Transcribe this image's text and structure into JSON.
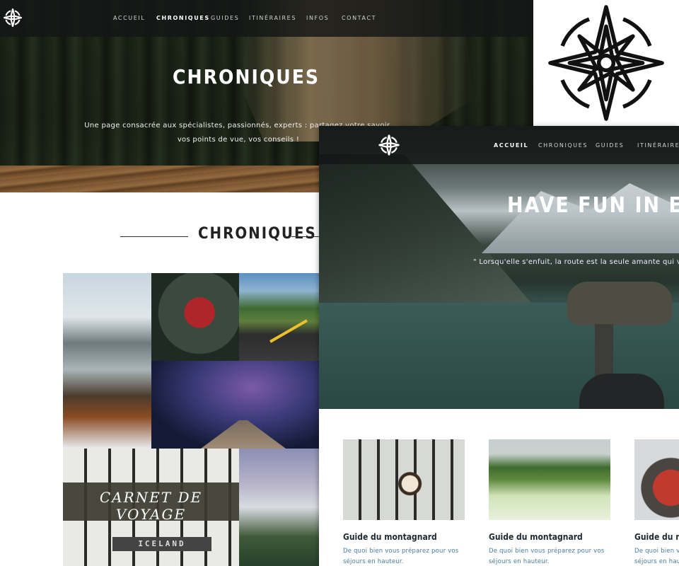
{
  "back_page": {
    "nav": [
      "ACCUEIL",
      "CHRONIQUES",
      "GUIDES",
      "ITINÉRAIRES",
      "INFOS",
      "CONTACT"
    ],
    "active_nav": "CHRONIQUES",
    "hero_title": "CHRONIQUES",
    "hero_subtitle_line1": "Une page consacrée aux spécialistes, passionnés, experts : partagez votre savoir,",
    "hero_subtitle_line2": "vos points de vue, vos conseils !",
    "section_title": "CHRONIQUES",
    "gallery_label": "CARNET DE VOYAGE",
    "iceland_text": "ICELAND"
  },
  "front_page": {
    "nav": [
      "ACCUEIL",
      "CHRONIQUES",
      "GUIDES",
      "ITINÉRAIRES"
    ],
    "active_nav": "ACCUEIL",
    "hero_title": "HAVE FUN IN EU",
    "hero_quote": "\" Lorsqu'elle s'enfuit, la route est la seule amante qui va",
    "cards": [
      {
        "title": "Guide du montagnard",
        "desc_line1": "De quoi bien vous préparez pour vos",
        "desc_line2": "séjours en hauteur."
      },
      {
        "title": "Guide du montagnard",
        "desc_line1": "De quoi bien vous préparez pour vos",
        "desc_line2": "séjours en hauteur."
      },
      {
        "title": "Guide du montagnard",
        "desc_line1": "De quoi bien vous préparez pour vos",
        "desc_line2": "séjours en haut"
      }
    ]
  },
  "icons": {
    "logo": "compass-rose-icon",
    "big_logo": "compass-rose-icon"
  },
  "colors": {
    "nav_bar": "#141616",
    "card_title": "#1f2a30",
    "card_desc": "#4b7aa0"
  }
}
